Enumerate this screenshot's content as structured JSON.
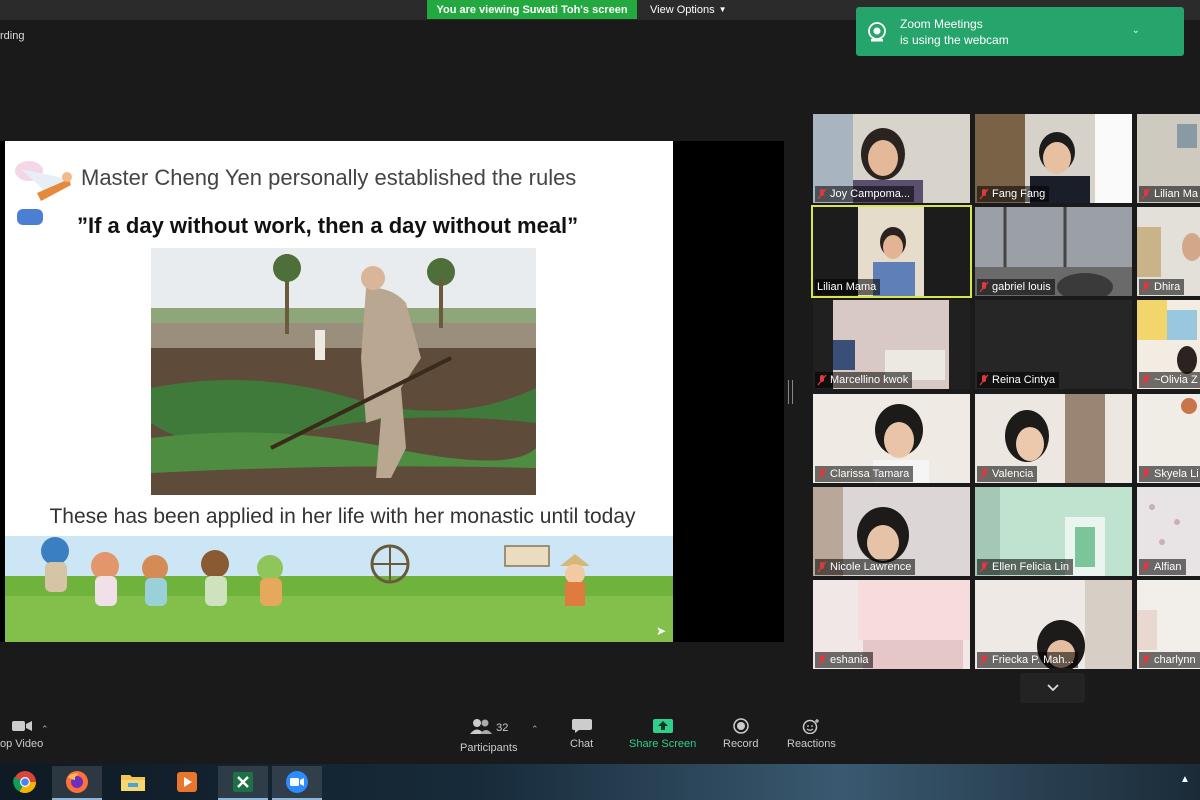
{
  "top_bar": {
    "viewing_banner": "You are viewing Suwati Toh's screen",
    "view_options": "View Options",
    "recording_label": "rding"
  },
  "notification": {
    "line1": "Zoom Meetings",
    "line2": "is using the webcam"
  },
  "slide": {
    "title": "Master Cheng Yen personally established the rules",
    "quote": "”If a day without work, then a day without meal”",
    "caption": "These has been applied in her life with her monastic until today"
  },
  "gallery": {
    "participants": [
      {
        "name": "Joy Campoma...",
        "muted": true
      },
      {
        "name": "Fang Fang",
        "muted": true
      },
      {
        "name": "Lilian Ma",
        "muted": true
      },
      {
        "name": "Lilian Mama",
        "muted": false,
        "active_speaker": true
      },
      {
        "name": "gabriel louis",
        "muted": true
      },
      {
        "name": "Dhira",
        "muted": true
      },
      {
        "name": "Marcellino kwok",
        "muted": true
      },
      {
        "name": "Reina Cintya",
        "muted": true
      },
      {
        "name": "~Olivia Z",
        "muted": true
      },
      {
        "name": "Clarissa Tamara",
        "muted": true
      },
      {
        "name": "Valencia",
        "muted": true
      },
      {
        "name": "Skyela Li",
        "muted": true
      },
      {
        "name": "Nicole Lawrence",
        "muted": true
      },
      {
        "name": "Ellen Felicia Lin",
        "muted": true
      },
      {
        "name": "Alfian",
        "muted": true
      },
      {
        "name": "eshania",
        "muted": true
      },
      {
        "name": "Friecka P. Mah...",
        "muted": true
      },
      {
        "name": "charlynn",
        "muted": true
      }
    ]
  },
  "controls": {
    "video_label": "op Video",
    "participants_label": "Participants",
    "participants_count": "32",
    "chat_label": "Chat",
    "share_label": "Share Screen",
    "record_label": "Record",
    "reactions_label": "Reactions"
  },
  "colors": {
    "banner_green": "#23a93f",
    "share_green": "#2fd08a",
    "notif_green": "#25a46b",
    "active_speaker": "#d7e64a",
    "muted_red": "#e0383e"
  },
  "taskbar": {
    "apps": [
      "chrome-icon",
      "firefox-icon",
      "file-explorer-icon",
      "media-player-icon",
      "excel-icon",
      "zoom-icon"
    ]
  }
}
